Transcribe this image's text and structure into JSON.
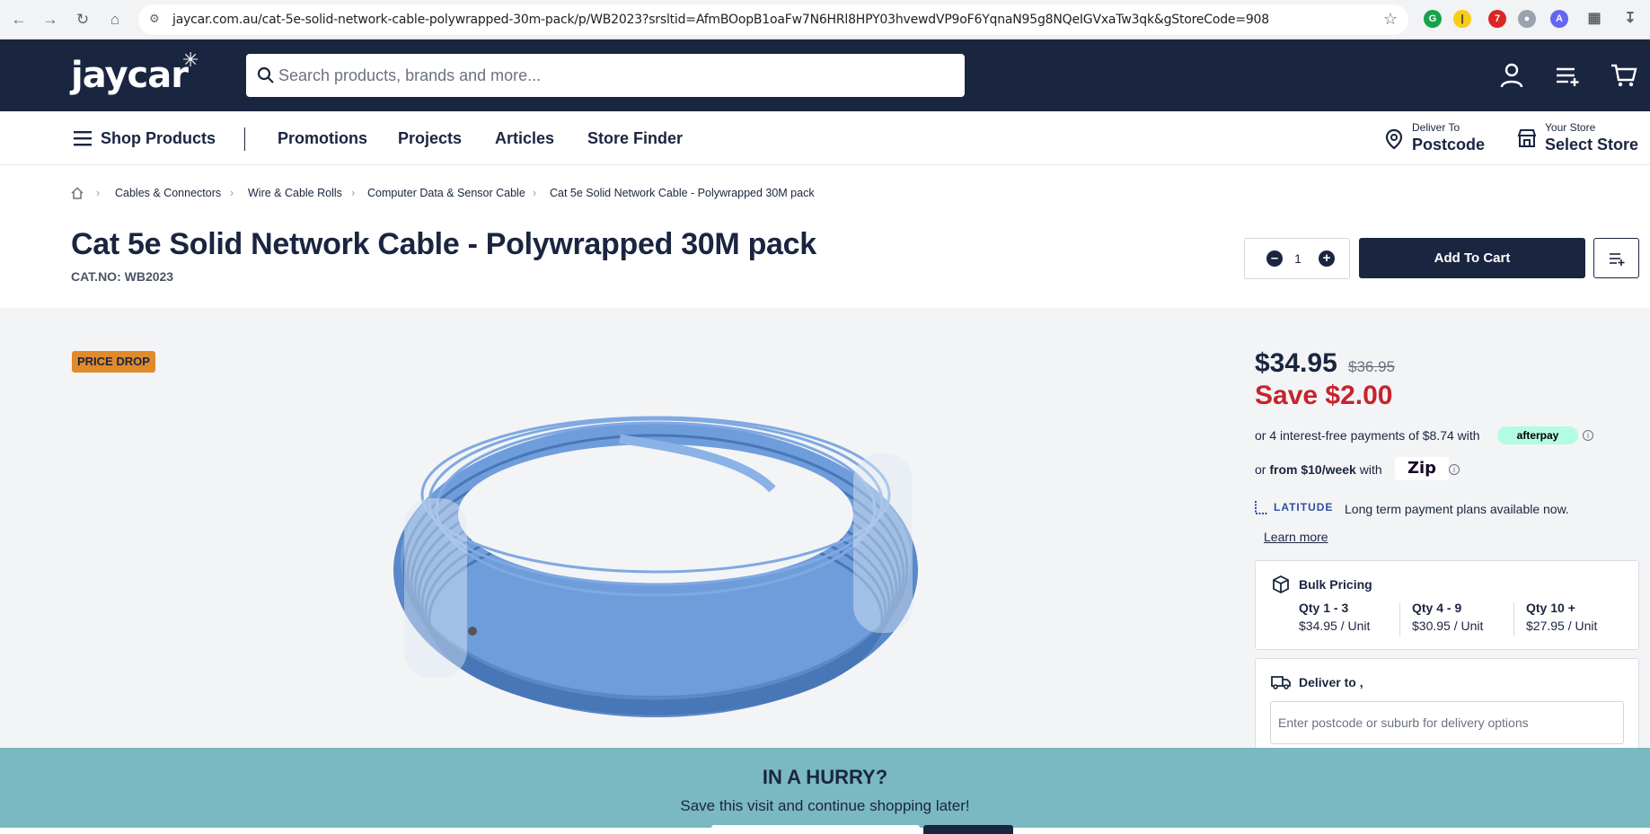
{
  "browser": {
    "url": "jaycar.com.au/cat-5e-solid-network-cable-polywrapped-30m-pack/p/WB2023?srsltid=AfmBOopB1oaFw7N6HRl8HPY03hvewdVP9oF6YqnaN95g8NQeIGVxaTw3qk&gStoreCode=908",
    "extension_badge": "7"
  },
  "header": {
    "logo": "jaycar",
    "search_placeholder": "Search products, brands and more..."
  },
  "subnav": {
    "shop_products": "Shop Products",
    "links": [
      "Promotions",
      "Projects",
      "Articles",
      "Store Finder"
    ],
    "deliver_small": "Deliver To",
    "deliver_big": "Postcode",
    "store_small": "Your Store",
    "store_big": "Select Store"
  },
  "breadcrumb": [
    "Cables & Connectors",
    "Wire & Cable Rolls",
    "Computer Data & Sensor Cable",
    "Cat 5e Solid Network Cable - Polywrapped 30M pack"
  ],
  "product": {
    "title": "Cat 5e Solid Network Cable - Polywrapped 30M pack",
    "catno": "CAT.NO: WB2023",
    "badge": "PRICE DROP",
    "quantity": "1",
    "add_to_cart": "Add To Cart"
  },
  "pricing": {
    "price": "$34.95",
    "was": "$36.95",
    "save": "Save $2.00",
    "afterpay_text": "or 4 interest-free payments of $8.74 with",
    "afterpay_logo": "afterpay",
    "zip_prefix": "or",
    "zip_bold": "from $10/week",
    "zip_with": "with",
    "zip_logo": "Zip",
    "latitude_logo": "LATITUDE",
    "latitude_text": "Long term payment plans available now.",
    "learn_more": "Learn more"
  },
  "bulk": {
    "title": "Bulk Pricing",
    "tiers": [
      {
        "qty": "Qty 1 - 3",
        "price": "$34.95 / Unit"
      },
      {
        "qty": "Qty 4 - 9",
        "price": "$30.95 / Unit"
      },
      {
        "qty": "Qty 10 +",
        "price": "$27.95 / Unit"
      }
    ]
  },
  "deliver": {
    "title": "Deliver to",
    "suffix": ",",
    "placeholder": "Enter postcode or suburb for delivery options"
  },
  "hurry": {
    "title": "IN A HURRY?",
    "subtitle": "Save this visit and continue shopping later!"
  },
  "colors": {
    "navy": "#1a2540",
    "save_red": "#c4252c",
    "badge_orange": "#e08a2b",
    "banner_teal": "#7ab8c2"
  }
}
